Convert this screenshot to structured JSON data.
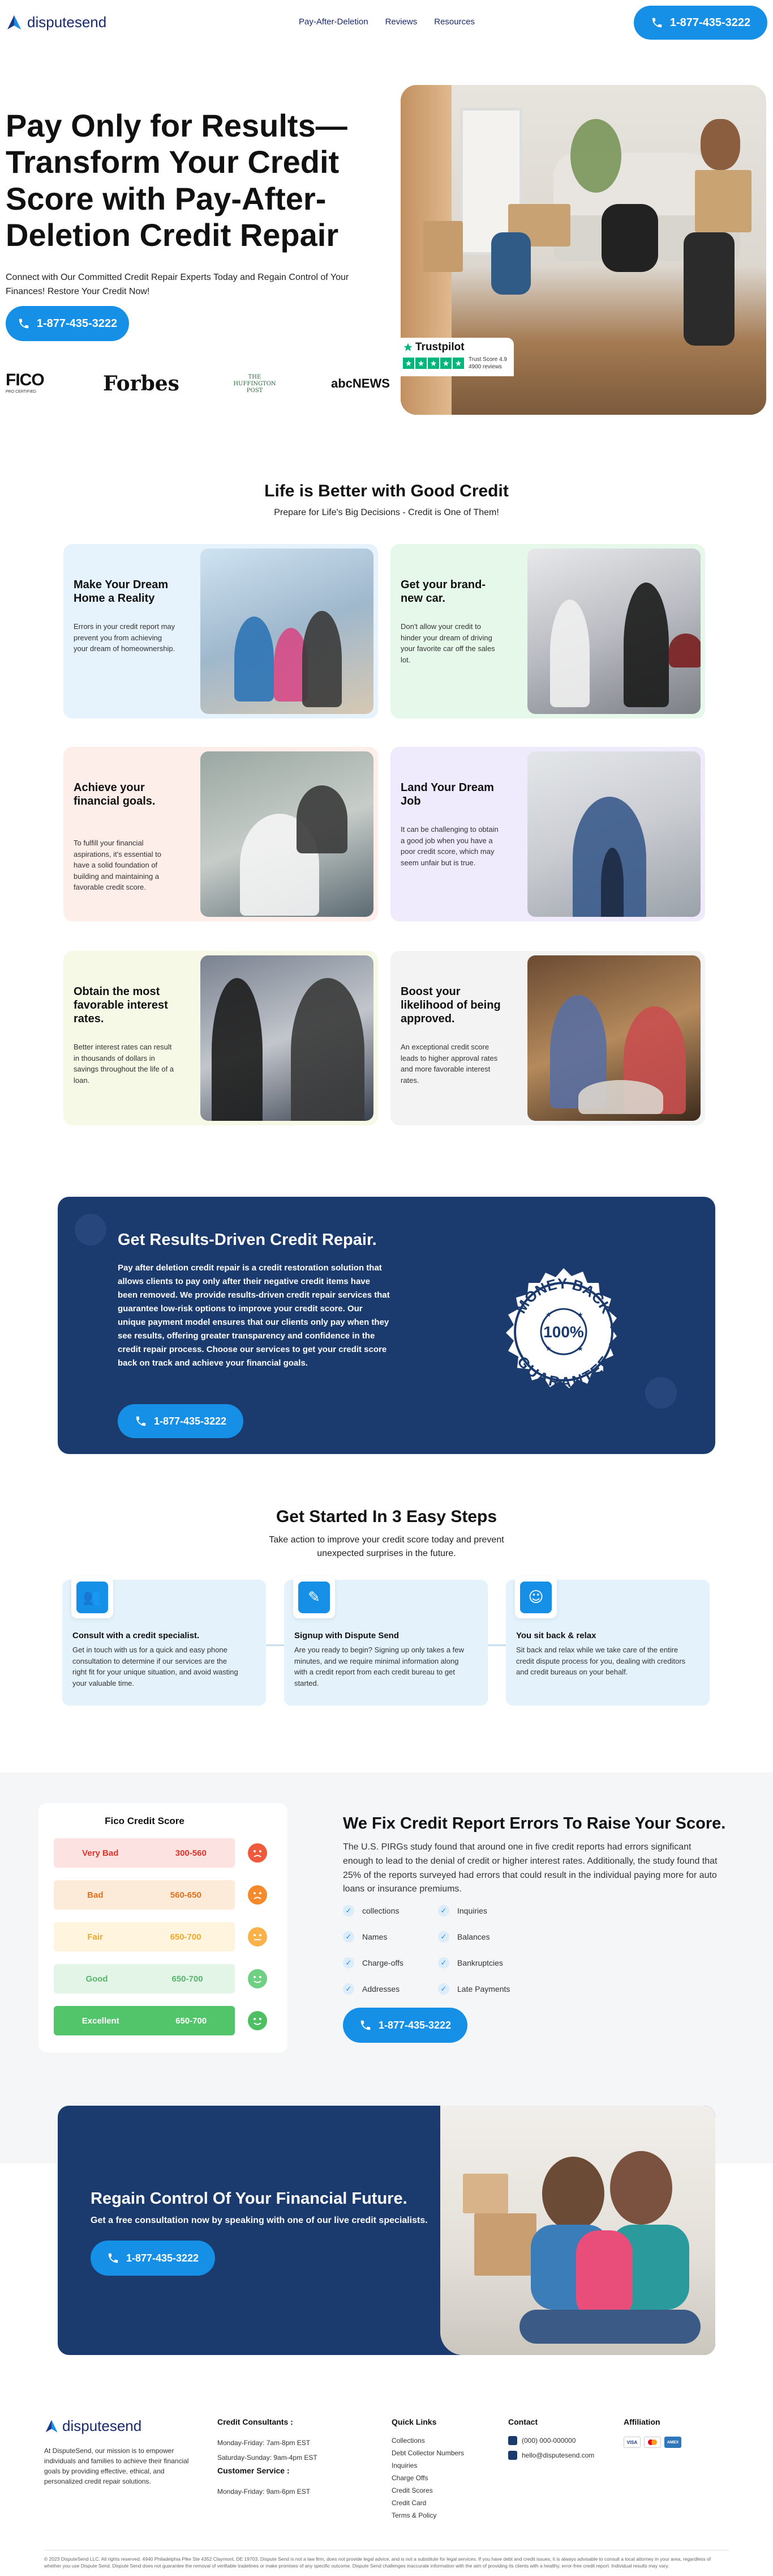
{
  "header": {
    "logo_text": "disputesend",
    "nav": [
      "Pay-After-Deletion",
      "Reviews",
      "Resources"
    ],
    "phone": "1-877-435-3222"
  },
  "hero": {
    "title": "Pay Only for Results—Transform Your Credit Score with Pay-After-Deletion Credit Repair",
    "subtitle": "Connect with Our Committed Credit Repair Experts Today and Regain Control of Your Finances! Restore Your Credit Now!",
    "phone": "1-877-435-3222",
    "logos": [
      "FICO",
      "Forbes",
      "THE HUFFINGTON POST",
      "abcNEWS"
    ],
    "fico_sub": "PRO CERTIFIED",
    "trustpilot": {
      "name": "Trustpilot",
      "score_label": "Trust Score 4.9",
      "reviews": "4900 reviews"
    }
  },
  "life": {
    "title": "Life is Better with Good Credit",
    "subtitle": "Prepare for Life's Big Decisions - Credit is One of Them!",
    "cards": [
      {
        "title": "Make Your Dream Home a Reality",
        "text": "Errors in your credit report may prevent you from achieving your dream of homeownership.",
        "bg": "#e6f3fc"
      },
      {
        "title": "Get your brand-new car.",
        "text": "Don't allow your credit to hinder your dream of driving your favorite car off the sales lot.",
        "bg": "#e6f8ea"
      },
      {
        "title": "Achieve your financial goals.",
        "text": "To fulfill your financial aspirations, it's essential to have a solid foundation of building and maintaining a favorable credit score.",
        "bg": "#fdeeea"
      },
      {
        "title": "Land Your Dream Job",
        "text": "It can be challenging to obtain a good job when you have a poor credit score, which may seem unfair but is true.",
        "bg": "#efeafc"
      },
      {
        "title": "Obtain the most favorable interest rates.",
        "text": "Better interest rates can result in thousands of dollars in savings throughout the life of a loan.",
        "bg": "#f6f9e6"
      },
      {
        "title": "Boost your likelihood of being approved.",
        "text": "An exceptional credit score leads to higher approval rates and more favorable interest rates.",
        "bg": "#f3f3f3"
      }
    ]
  },
  "results": {
    "title": "Get Results-Driven Credit Repair.",
    "body": "Pay after deletion credit repair is a credit restoration solution that allows clients to pay only after their negative credit items have been removed. We provide results-driven credit repair services that guarantee low-risk options to improve your credit score. Our unique payment model ensures that our clients only pay when they see results, offering greater transparency and confidence in the credit repair process. Choose our services to get your credit score back on track and achieve your financial goals.",
    "phone": "1-877-435-3222",
    "badge_top": "MONEY BACK",
    "badge_pct": "100%",
    "badge_bottom": "GUARANTEE"
  },
  "steps": {
    "title": "Get Started In 3 Easy Steps",
    "subtitle": "Take action to improve your credit score today and prevent unexpected surprises in the future.",
    "items": [
      {
        "title": "Consult with a credit specialist.",
        "text": "Get in touch with us for a quick and easy phone consultation to determine if our services are the right fit for your unique situation, and avoid wasting your valuable time."
      },
      {
        "title": "Signup with Dispute Send",
        "text": "Are you ready to begin? Signing up only takes a few minutes, and we require minimal information along with a credit report from each credit bureau to get started."
      },
      {
        "title": "You sit back & relax",
        "text": "Sit back and relax while we take care of the entire credit dispute process for you, dealing with creditors and credit bureaus on your behalf."
      }
    ]
  },
  "fix": {
    "score_title": "Fico Credit Score",
    "scores": [
      {
        "label": "Very Bad",
        "range": "300-560",
        "color": "#fde2e2",
        "text": "#d9342b",
        "face": "#f05a3c"
      },
      {
        "label": "Bad",
        "range": "560-650",
        "color": "#fdebd9",
        "text": "#e0701c",
        "face": "#f58a2c"
      },
      {
        "label": "Fair",
        "range": "650-700",
        "color": "#fff4dd",
        "text": "#f0a82c",
        "face": "#f9b24a"
      },
      {
        "label": "Good",
        "range": "650-700",
        "color": "#e2f5e6",
        "text": "#57b66b",
        "face": "#6fcf83"
      },
      {
        "label": "Excellent",
        "range": "650-700",
        "color": "#52c46a",
        "text": "#ffffff",
        "face": "#4fbf64"
      }
    ],
    "title": "We Fix Credit Report Errors To Raise Your Score.",
    "body": "The U.S. PIRGs study found that around one in five credit reports had errors significant enough to lead to the denial of credit or higher interest rates. Additionally, the study found that 25% of the reports surveyed had errors that could result in the individual paying more for auto loans or insurance premiums.",
    "left_items": [
      "collections",
      "Names",
      "Charge-offs",
      "Addresses"
    ],
    "right_items": [
      "Inquiries",
      "Balances",
      "Bankruptcies",
      "Late Payments"
    ],
    "phone": "1-877-435-3222"
  },
  "regain": {
    "title": "Regain Control Of Your Financial Future.",
    "subtitle": "Get a free consultation now by speaking with one of our live credit specialists.",
    "phone": "1-877-435-3222"
  },
  "footer": {
    "logo_text": "disputesend",
    "about": "At DisputeSend, our mission is to empower individuals and families to achieve their financial goals by providing effective, ethical, and personalized credit repair solutions.",
    "consultants_title": "Credit Consultants :",
    "consultants_hours": [
      "Monday-Friday: 7am-8pm EST",
      "Saturday-Sunday: 9am-4pm EST"
    ],
    "service_title": "Customer Service :",
    "service_hours": "Monday-Friday: 9am-6pm EST",
    "links_title": "Quick Links",
    "links": [
      "Collections",
      "Debt Collector Numbers",
      "Inquiries",
      "Charge Offs",
      "Credit Scores",
      "Credit Card",
      "Terms & Policy"
    ],
    "contact_title": "Contact",
    "contact_phone": "(000) 000-000000",
    "contact_email": "hello@disputesend.com",
    "affiliation_title": "Affiliation",
    "cards": [
      "VISA",
      "MC",
      "AMEX"
    ],
    "legal": "© 2023 DisputeSend LLC. All rights reserved. 4940 Philadelphia Pike Ste 4352 Claymont, DE 19703. Dispute Send is not a law firm, does not provide legal advice, and is not a substitute for legal services. If you have debt and credit issues, it is always advisable to consult a local attorney in your area, regardless of whether you use Dispute Send. Dispute Send does not guarantee the removal of verifiable tradelines or make promises of any specific outcome. Dispute Send challenges inaccurate information with the aim of providing its clients with a healthy, error-free credit report. Individual results may vary."
  }
}
